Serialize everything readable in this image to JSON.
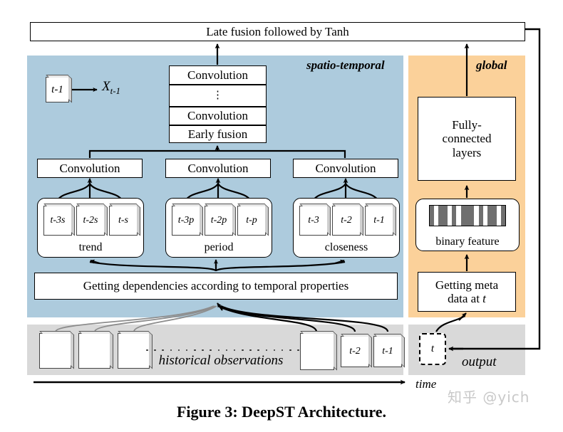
{
  "caption": "Figure 3: DeepST Architecture.",
  "watermark": "知乎 @yich",
  "colors": {
    "spatio_temporal_panel": "#adcbdd",
    "global_panel": "#fbd19a",
    "band": "#d9d9d9",
    "stroke": "#000000"
  },
  "top": {
    "late_fusion": "Late fusion followed by Tanh"
  },
  "spatio_temporal": {
    "label": "spatio-temporal",
    "sample_card": "t-1",
    "sample_output": "X",
    "sample_output_sub": "t-1",
    "stack": {
      "conv_top": "Convolution",
      "dots": "⋮",
      "conv_mid": "Convolution",
      "early_fusion": "Early fusion"
    },
    "branches": [
      {
        "conv": "Convolution",
        "name": "trend",
        "tiles": [
          "t-3s",
          "t-2s",
          "t-s"
        ]
      },
      {
        "conv": "Convolution",
        "name": "period",
        "tiles": [
          "t-3p",
          "t-2p",
          "t-p"
        ]
      },
      {
        "conv": "Convolution",
        "name": "closeness",
        "tiles": [
          "t-3",
          "t-2",
          "t-1"
        ]
      }
    ],
    "dependencies": "Getting dependencies according to temporal properties"
  },
  "global": {
    "label": "global",
    "fully_connected": "Fully-\nconnected\nlayers",
    "fc_line1": "Fully-",
    "fc_line2": "connected",
    "fc_line3": "layers",
    "binary_feature": "binary feature",
    "binary_pattern": [
      1,
      0,
      1,
      1,
      0,
      1,
      0,
      1,
      1,
      1,
      0,
      1,
      0,
      1,
      1,
      0,
      1
    ],
    "meta_line1": "Getting meta",
    "meta_line2_pre": "data at ",
    "meta_line2_var": "t"
  },
  "history": {
    "label": "historical observations",
    "cards": [
      "",
      "",
      "",
      "",
      "t-2",
      "t-1"
    ]
  },
  "output": {
    "label": "output",
    "box": "t"
  },
  "axis": {
    "time": "time"
  }
}
